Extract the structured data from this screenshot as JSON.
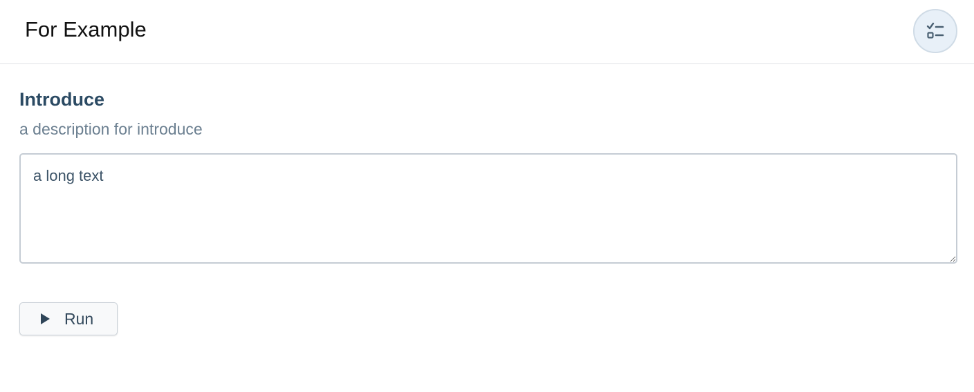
{
  "header": {
    "title": "For Example",
    "action_icon": "checklist-icon"
  },
  "field": {
    "title": "Introduce",
    "description": "a description for introduce",
    "value": "a long text"
  },
  "actions": {
    "run_label": "Run",
    "run_icon": "play-icon"
  },
  "colors": {
    "accent_text": "#2b4a63",
    "muted_text": "#6b7f90",
    "icon_bg": "#e8f0f8"
  }
}
